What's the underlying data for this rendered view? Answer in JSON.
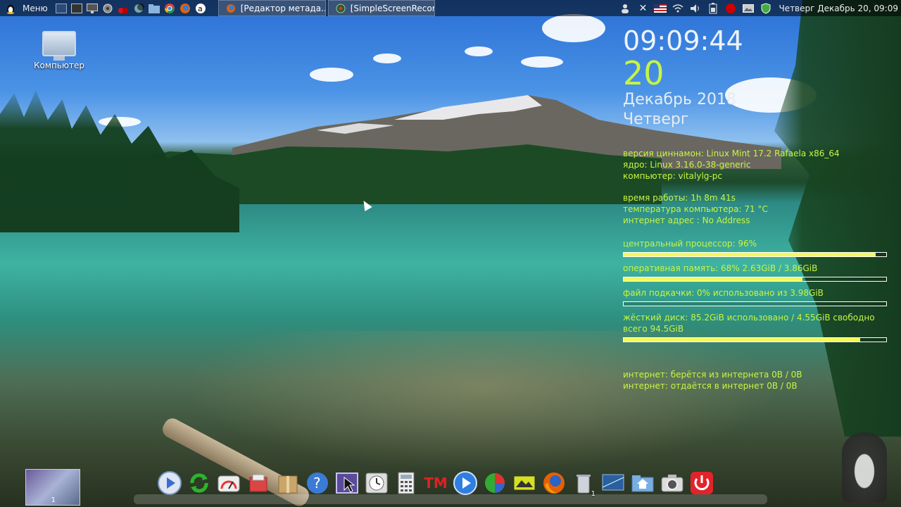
{
  "top_panel": {
    "menu_label": "Меню",
    "launchers": [
      "terminal-icon",
      "files-icon",
      "monitor-icon",
      "settings-icon",
      "cherry-icon",
      "moon-icon",
      "folder-icon",
      "chrome-icon",
      "firefox-icon",
      "amazon-icon"
    ],
    "windows": [
      {
        "title": "[Редактор метада..."
      },
      {
        "title": "[SimpleScreenRecor..."
      }
    ],
    "tray_icons": [
      "user-icon",
      "close-icon",
      "flag-us-icon",
      "wifi-icon",
      "volume-icon",
      "battery-icon",
      "record-icon",
      "screenshot-icon",
      "shield-icon"
    ],
    "clock": "Четверг Декабрь 20, 09:09"
  },
  "desktop": {
    "icons": [
      {
        "label": "Компьютер"
      }
    ]
  },
  "conky": {
    "time": "09:09:44",
    "day": "20",
    "month_year": "Декабрь 2018",
    "weekday": "Четверг",
    "lines": {
      "cinnamon": "версия циннамон: Linux Mint 17.2 Rafaela x86_64",
      "kernel": "ядро: Linux 3.16.0-38-generic",
      "computer": "компьютер: vitalylg-pc",
      "uptime": "время работы: 1h 8m 41s",
      "temp": "температура компьютера: 71  °C",
      "ip": "интернет адрес  : No Address",
      "cpu": "центральный процессор: 96%",
      "ram": "оперативная память: 68% 2.63GiB / 3.86GiB",
      "swap": "файл подкачки: 0% использовано из 3.98GiB",
      "disk1": "жёсткий диск: 85.2GiB использовано / 4.55GiB свободно",
      "disk2": "всего 94.5GiB",
      "net_down": "интернет: берётся из интернета 0B     / 0B",
      "net_up": "интернет: отдаётся в интернет 0B     / 0B"
    },
    "bars": {
      "cpu": 0.96,
      "ram": 0.68,
      "swap": 0.0,
      "disk": 0.9
    },
    "colors": {
      "text": "#c7f542",
      "bar": "#f4f85a"
    }
  },
  "dock": {
    "workspace_num": "1",
    "trash_badge": "1",
    "items": [
      "media-player-icon",
      "update-icon",
      "speedometer-icon",
      "package-installer-icon",
      "archive-icon",
      "help-icon",
      "window-select-icon",
      "clock-icon",
      "calculator-icon",
      "task-manager-icon",
      "play-icon",
      "color-picker-icon",
      "display-icon",
      "firefox-icon",
      "trash-icon",
      "screen-icon",
      "home-folder-icon",
      "camera-icon",
      "power-icon"
    ],
    "task_manager_label": "TM"
  }
}
